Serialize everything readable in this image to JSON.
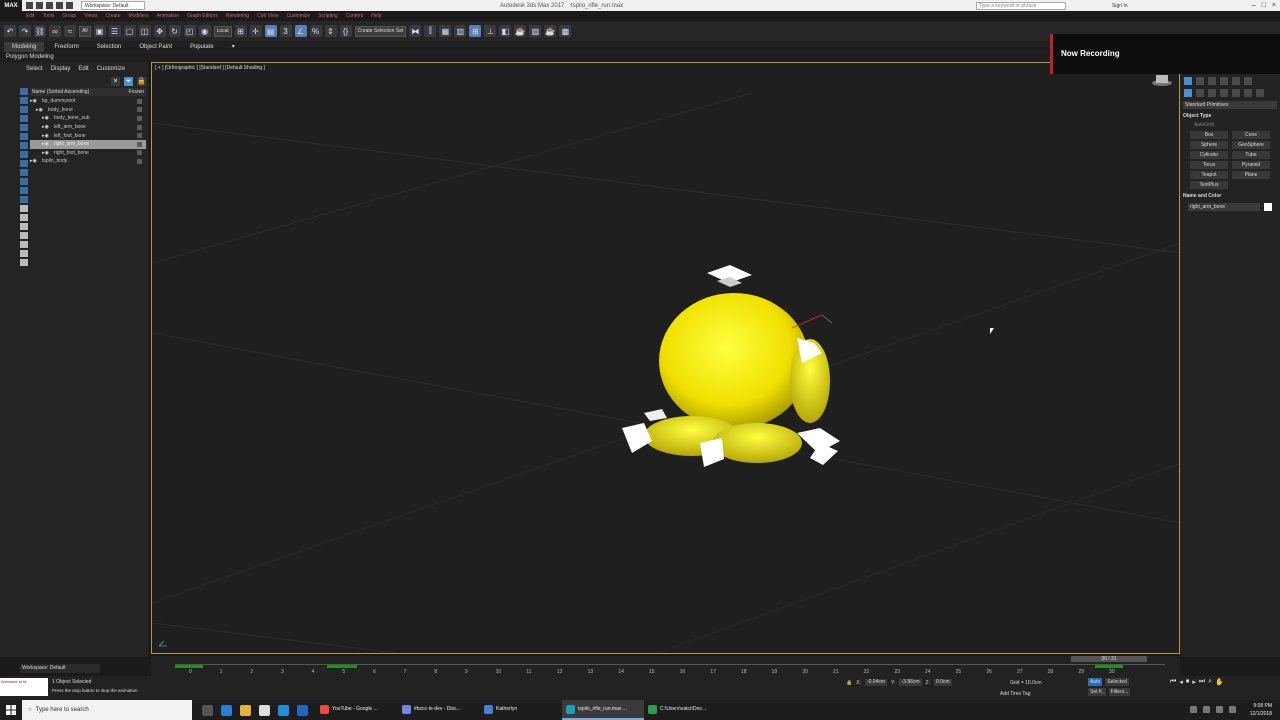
{
  "window": {
    "app_title": "Autodesk 3ds Max 2017",
    "file_name": "tspilo_rifle_run.max",
    "search_placeholder": "Type a keyword or phrase",
    "sign_in": "Sign In",
    "workspace": "Workspace: Default",
    "logo": "MAX"
  },
  "menubar": [
    "Edit",
    "Tools",
    "Group",
    "Views",
    "Create",
    "Modifiers",
    "Animation",
    "Graph Editors",
    "Rendering",
    "Civil View",
    "Customize",
    "Scripting",
    "Content",
    "Help"
  ],
  "toolbar": {
    "filter": "All",
    "ref_coord": "Local",
    "selection_set": "Create Selection Set"
  },
  "ribbon": {
    "tabs": [
      "Modeling",
      "Freeform",
      "Selection",
      "Object Paint",
      "Populate"
    ],
    "active_tab": "Modeling",
    "subtitle": "Polygon Modeling"
  },
  "scene_explorer": {
    "menu": [
      "Select",
      "Display",
      "Edit",
      "Customize"
    ],
    "header_name": "Name (Sorted Ascending)",
    "header_frozen": "Frozen",
    "tree": [
      {
        "label": "bp_dummyroot",
        "indent": 0,
        "selected": false
      },
      {
        "label": "body_bone",
        "indent": 1,
        "selected": false
      },
      {
        "label": "body_bone_sub",
        "indent": 2,
        "selected": false
      },
      {
        "label": "left_arm_bone",
        "indent": 2,
        "selected": false
      },
      {
        "label": "left_foot_bone",
        "indent": 2,
        "selected": false
      },
      {
        "label": "right_arm_bone",
        "indent": 2,
        "selected": true
      },
      {
        "label": "right_foot_bone",
        "indent": 2,
        "selected": false
      },
      {
        "label": "tspilo_body",
        "indent": 0,
        "selected": false
      }
    ],
    "workspace": "Workspace: Default"
  },
  "viewport": {
    "label": "[ + ] [Orthographic ] [Standard ] [Default Shading ]"
  },
  "recording": {
    "text": "Now Recording"
  },
  "command_panel": {
    "category": "Standard Primitives",
    "object_type_title": "Object Type",
    "autogrid": "AutoGrid",
    "primitives": [
      "Box",
      "Cone",
      "Sphere",
      "GeoSphere",
      "Cylinder",
      "Tube",
      "Torus",
      "Pyramid",
      "Teapot",
      "Plane",
      "TextPlus"
    ],
    "name_color_title": "Name and Color",
    "object_name": "right_arm_bone"
  },
  "timeline": {
    "slider": "30 / 31",
    "ticks": [
      "0",
      "1",
      "2",
      "3",
      "4",
      "5",
      "6",
      "7",
      "8",
      "9",
      "10",
      "11",
      "12",
      "13",
      "14",
      "15",
      "16",
      "17",
      "18",
      "19",
      "20",
      "21",
      "22",
      "23",
      "24",
      "25",
      "26",
      "27",
      "28",
      "29",
      "30"
    ]
  },
  "status": {
    "script_text": "Welcome to M",
    "selected": "1 Object Selected",
    "prompt": "Press the stop button to stop the animation",
    "x_label": "X:",
    "x_value": "-0.04cm",
    "y_label": "Y:",
    "y_value": "-3.86cm",
    "z_label": "Z:",
    "z_value": "0.0cm",
    "grid": "Grid = 10.0cm",
    "add_time_tag": "Add Time Tag",
    "auto": "Auto",
    "set_key": "Set K.",
    "selected_set": "Selected",
    "filters": "Filters..."
  },
  "taskbar": {
    "search_placeholder": "Type here to search",
    "apps": [
      {
        "label": "YouTube - Google ...",
        "color": "#e94b3c",
        "active": false
      },
      {
        "label": "#bzcc-le-dev - Disc...",
        "color": "#7289da",
        "active": false
      },
      {
        "label": "Katherlyn",
        "color": "#4a7fd0",
        "active": false
      },
      {
        "label": "tspilo_rifle_run.max ...",
        "color": "#1aa0b0",
        "active": true
      },
      {
        "label": "C:\\Users\\vatrz\\Doc...",
        "color": "#2e9e4a",
        "active": false
      }
    ],
    "time": "9:08 PM",
    "date": "12/1/2018"
  }
}
